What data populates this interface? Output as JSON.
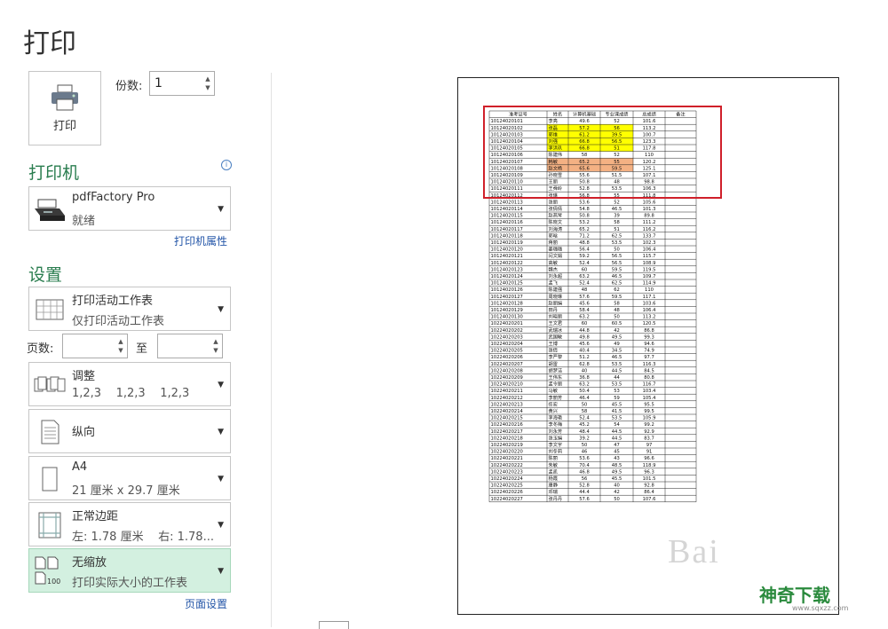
{
  "page": {
    "title": "打印"
  },
  "print_button": {
    "label": "打印"
  },
  "copies": {
    "label": "份数:",
    "value": "1"
  },
  "printer": {
    "section_title": "打印机",
    "name": "pdfFactory Pro",
    "status": "就绪",
    "properties_link": "打印机属性"
  },
  "settings": {
    "section_title": "设置",
    "scope": {
      "title": "打印活动工作表",
      "subtitle": "仅打印活动工作表"
    },
    "pages": {
      "label": "页数:",
      "from": "",
      "to_label": "至",
      "to": ""
    },
    "collate": {
      "title": "调整",
      "subtitle": "1,2,3    1,2,3    1,2,3"
    },
    "orientation": {
      "title": "纵向"
    },
    "paper": {
      "title": "A4",
      "subtitle": "21 厘米 x 29.7 厘米"
    },
    "margins": {
      "title": "正常边距",
      "subtitle": "左: 1.78 厘米    右: 1.78..."
    },
    "scaling": {
      "title": "无缩放",
      "subtitle": "打印实际大小的工作表"
    },
    "page_setup_link": "页面设置"
  },
  "preview": {
    "headers": [
      "准考证号",
      "姓名",
      "计算机基础",
      "专业课成绩",
      "总成绩",
      "备注"
    ],
    "rows": [
      [
        "10124020101",
        "李亮",
        "49.6",
        "52",
        "101.6"
      ],
      [
        "10124020102",
        "张磊",
        "57.2",
        "56",
        "113.2"
      ],
      [
        "10124020103",
        "郭维",
        "61.2",
        "39.5",
        "100.7"
      ],
      [
        "10124020104",
        "刘强",
        "66.8",
        "56.5",
        "123.3"
      ],
      [
        "10124020105",
        "李洪玖",
        "66.8",
        "51",
        "117.8"
      ],
      [
        "10124020106",
        "陈建伟",
        "58",
        "52",
        "110"
      ],
      [
        "10124020107",
        "韩敏",
        "65.2",
        "55",
        "120.2"
      ],
      [
        "10124020108",
        "赵文杨",
        "65.6",
        "59.5",
        "125.1"
      ],
      [
        "10124020109",
        "孙晓雪",
        "55.6",
        "51.5",
        "107.1"
      ],
      [
        "10124020110",
        "王丽",
        "50.8",
        "48",
        "98.8"
      ],
      [
        "10124020111",
        "王舜岭",
        "52.8",
        "53.5",
        "106.3"
      ],
      [
        "10124020112",
        "张琳",
        "56.8",
        "55",
        "111.8"
      ],
      [
        "10124020113",
        "张丽",
        "53.6",
        "52",
        "105.6"
      ],
      [
        "10124020114",
        "张倩倩",
        "54.8",
        "46.5",
        "101.3"
      ],
      [
        "10124020115",
        "赵燕琴",
        "50.8",
        "39",
        "89.8"
      ],
      [
        "10124020116",
        "陈晓文",
        "53.2",
        "58",
        "111.2"
      ],
      [
        "10124020117",
        "刘海涛",
        "65.2",
        "51",
        "116.2"
      ],
      [
        "10124020118",
        "郭晗",
        "71.2",
        "62.5",
        "133.7"
      ],
      [
        "10124020119",
        "蒋丽",
        "48.8",
        "53.5",
        "102.3"
      ],
      [
        "10124020120",
        "姜璐璐",
        "56.4",
        "50",
        "106.4"
      ],
      [
        "10124020121",
        "闫文娟",
        "59.2",
        "56.5",
        "115.7"
      ],
      [
        "10124020122",
        "高敏",
        "52.4",
        "56.5",
        "108.9"
      ],
      [
        "10124020123",
        "魏杰",
        "60",
        "59.5",
        "119.5"
      ],
      [
        "10124020124",
        "刘永超",
        "63.2",
        "46.5",
        "109.7"
      ],
      [
        "10124020125",
        "孟飞",
        "52.4",
        "62.5",
        "114.9"
      ],
      [
        "10124020126",
        "陈建强",
        "48",
        "62",
        "110"
      ],
      [
        "10124020127",
        "周晓琳",
        "57.6",
        "59.5",
        "117.1"
      ],
      [
        "10124020128",
        "赵丽娟",
        "45.6",
        "58",
        "103.6"
      ],
      [
        "10124020129",
        "田丹",
        "58.4",
        "48",
        "106.4"
      ],
      [
        "10124020130",
        "刘晓丽",
        "63.2",
        "50",
        "113.2"
      ],
      [
        "10224020201",
        "王文君",
        "60",
        "60.5",
        "120.5"
      ],
      [
        "10224020202",
        "武瑞冰",
        "44.8",
        "42",
        "86.8"
      ],
      [
        "10224020203",
        "武国敏",
        "49.8",
        "49.5",
        "99.3"
      ],
      [
        "10224020204",
        "王博",
        "45.6",
        "49",
        "94.6"
      ],
      [
        "10224020205",
        "张倩",
        "40.4",
        "34.5",
        "74.9"
      ],
      [
        "10224020206",
        "李严黎",
        "51.2",
        "46.5",
        "97.7"
      ],
      [
        "10224020207",
        "胡雷",
        "62.8",
        "53.5",
        "116.3"
      ],
      [
        "10224020208",
        "胡梦洁",
        "40",
        "44.5",
        "84.5"
      ],
      [
        "10224020209",
        "王伟东",
        "36.8",
        "44",
        "80.8"
      ],
      [
        "10224020210",
        "孟令丽",
        "63.2",
        "53.5",
        "116.7"
      ],
      [
        "10224020211",
        "马敏",
        "50.4",
        "53",
        "103.4"
      ],
      [
        "10224020212",
        "李丽芳",
        "46.4",
        "59",
        "105.4"
      ],
      [
        "10224020213",
        "任宏",
        "50",
        "45.5",
        "95.5"
      ],
      [
        "10224020214",
        "黄兴",
        "58",
        "41.5",
        "99.5"
      ],
      [
        "10224020215",
        "李海艳",
        "52.4",
        "53.5",
        "105.9"
      ],
      [
        "10224020216",
        "李冬梅",
        "45.2",
        "54",
        "99.2"
      ],
      [
        "10224020217",
        "刘永芳",
        "48.4",
        "44.5",
        "92.9"
      ],
      [
        "10224020218",
        "张玉娟",
        "39.2",
        "44.5",
        "83.7"
      ],
      [
        "10224020219",
        "李文宇",
        "50",
        "47",
        "97"
      ],
      [
        "10224020220",
        "刘冬莉",
        "46",
        "45",
        "91"
      ],
      [
        "10224020221",
        "陈丽",
        "53.6",
        "43",
        "96.6"
      ],
      [
        "10224020222",
        "朱敏",
        "70.4",
        "48.5",
        "118.9"
      ],
      [
        "10224020223",
        "孟凯",
        "46.8",
        "49.5",
        "96.3"
      ],
      [
        "10224020224",
        "杨霞",
        "56",
        "45.5",
        "101.5"
      ],
      [
        "10224020225",
        "唐静",
        "52.8",
        "40",
        "92.8"
      ],
      [
        "10224020226",
        "邓瑞",
        "44.4",
        "42",
        "86.4"
      ],
      [
        "10224020227",
        "张丹丹",
        "57.6",
        "50",
        "107.6"
      ]
    ]
  },
  "watermark": {
    "text": "Bai",
    "brand": "神奇下载",
    "url": "www.sqxzz.com"
  },
  "colors": {
    "accent_green": "#2a7d4f",
    "selected_bg": "#d3f0e0",
    "highlight_yellow": "#ffff00",
    "highlight_orange": "#f4b183",
    "annotation_red": "#d0202a"
  }
}
